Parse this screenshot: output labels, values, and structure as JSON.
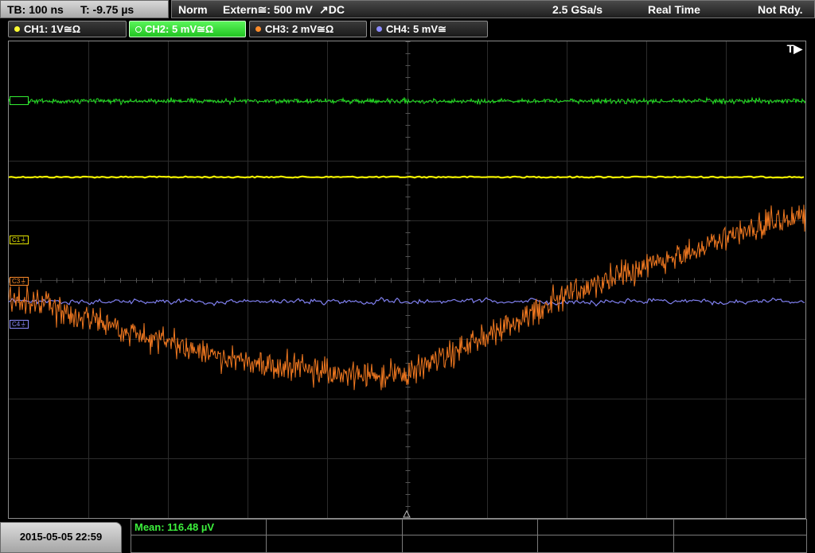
{
  "top_bar": {
    "timebase": "TB: 100 ns",
    "trigger_time": "T: -9.75 µs",
    "trigger_mode": "Norm",
    "trigger_source": "Extern≅: 500 mV",
    "trigger_slope_coupling": "↗DC",
    "sample_rate": "2.5 GSa/s",
    "acquisition_mode": "Real Time",
    "status": "Not Rdy."
  },
  "channels": [
    {
      "label": "CH1: 1V≅Ω",
      "color": "#ffff33",
      "active": false
    },
    {
      "label": "CH2: 5 mV≅Ω",
      "color": "#33ee33",
      "active": true
    },
    {
      "label": "CH3: 2 mV≅Ω",
      "color": "#ff8c2a",
      "active": false
    },
    {
      "label": "CH4: 5 mV≅",
      "color": "#8c8cff",
      "active": false
    }
  ],
  "plot": {
    "trigger_position_label": "T▶",
    "channel_markers": [
      {
        "label": "C1⏚",
        "color": "#e8e800"
      },
      {
        "label": "C3⏚",
        "color": "#ff8c2a"
      },
      {
        "label": "C4⏚",
        "color": "#8c8cff"
      }
    ]
  },
  "footer": {
    "datetime": "2015-05-05 22:59",
    "measurement": "Mean: 116.48 µV"
  }
}
